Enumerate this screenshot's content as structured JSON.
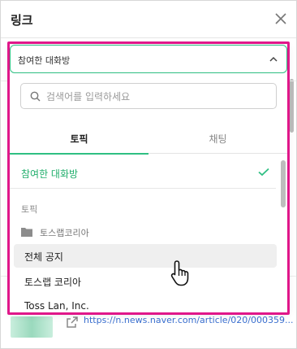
{
  "header": {
    "title": "링크",
    "close_icon": "close-icon"
  },
  "dropdown": {
    "selected": "참여한 대화방",
    "chevron_icon": "chevron-up-icon",
    "search": {
      "placeholder": "검색어를 입력하세요",
      "value": ""
    },
    "tabs": [
      {
        "label": "토픽",
        "active": true
      },
      {
        "label": "채팅",
        "active": false
      }
    ],
    "joined_option": {
      "label": "참여한 대화방",
      "checked": true
    },
    "section_label": "토픽",
    "folder": {
      "icon": "folder-icon",
      "label": "토스랩코리아"
    },
    "items": [
      {
        "label": "전체 공지",
        "hovered": true
      },
      {
        "label": "토스랩 코리아",
        "hovered": false
      },
      {
        "label": "Toss Lan, Inc.",
        "hovered": false
      }
    ]
  },
  "background": {
    "link_text": "https://n.news.naver.com/article/020/000359..."
  },
  "colors": {
    "accent": "#2fbf83",
    "highlight": "#e0178a",
    "link": "#3a6fcf"
  }
}
